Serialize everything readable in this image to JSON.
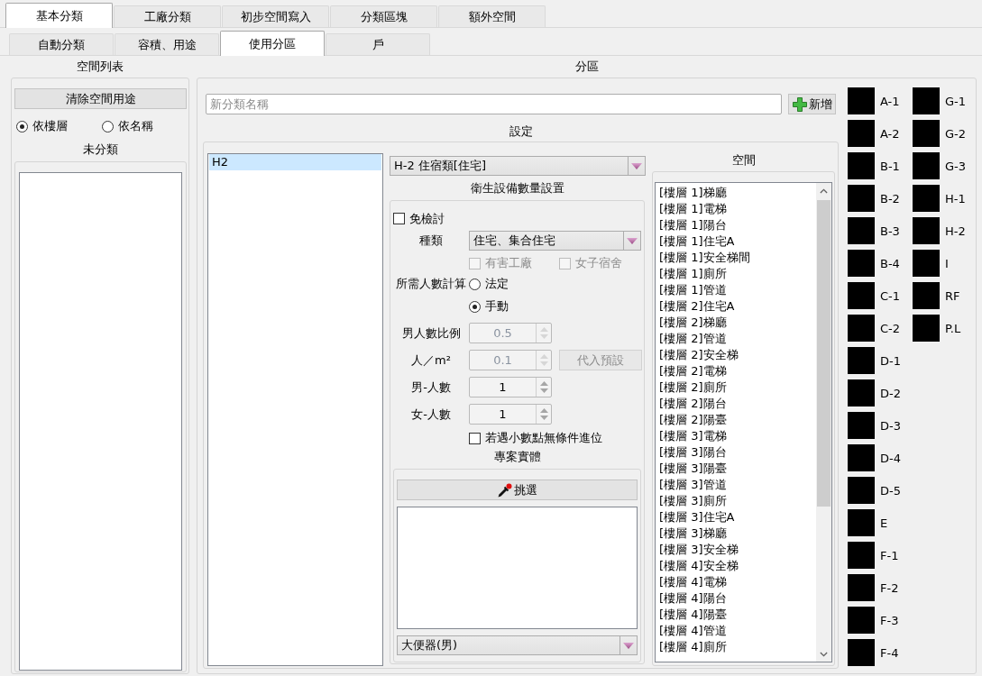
{
  "tabs": [
    {
      "label": "基本分類",
      "selected": true
    },
    {
      "label": "工廠分類",
      "selected": false
    },
    {
      "label": "初步空間寫入",
      "selected": false
    },
    {
      "label": "分類區塊",
      "selected": false
    },
    {
      "label": "額外空間",
      "selected": false
    }
  ],
  "subtabs": [
    {
      "label": "自動分類",
      "selected": false
    },
    {
      "label": "容積、用途",
      "selected": false
    },
    {
      "label": "使用分區",
      "selected": true
    },
    {
      "label": "戶",
      "selected": false
    }
  ],
  "space_list": {
    "title": "空間列表",
    "clear_button": "清除空間用途",
    "sort_options": [
      {
        "label": "依樓層",
        "selected": true
      },
      {
        "label": "依名稱",
        "selected": false
      }
    ],
    "unclassified_title": "未分類"
  },
  "zoning": {
    "title": "分區",
    "name_field": {
      "placeholder": "新分類名稱"
    },
    "add_button": "新增",
    "settings": {
      "title": "設定",
      "categories": [
        {
          "label": "H2",
          "selected": true
        }
      ],
      "use_type": "H-2 住宿類[住宅]",
      "sanitary": {
        "title": "衛生設備數量設置",
        "exempt": {
          "label": "免檢討",
          "checked": false
        },
        "type_label": "種類",
        "type_value": "住宅、集合住宅",
        "type_options": [
          {
            "label": "有害工廠",
            "checked": false,
            "disabled": true
          },
          {
            "label": "女子宿舍",
            "checked": false,
            "disabled": true
          }
        ],
        "calc_label": "所需人數計算",
        "calc_modes": [
          {
            "label": "法定",
            "selected": false
          },
          {
            "label": "手動",
            "selected": true
          }
        ],
        "fields": [
          {
            "label": "男人數比例",
            "value": "0.5",
            "disabled": true
          },
          {
            "label": "人／m²",
            "value": "0.1",
            "disabled": true,
            "button": {
              "label": "代入預設",
              "disabled": true
            }
          },
          {
            "label": "男-人數",
            "value": "1",
            "disabled": false
          },
          {
            "label": "女-人數",
            "value": "1",
            "disabled": false
          }
        ],
        "round_up": {
          "label": "若遇小數點無條件進位",
          "checked": false
        },
        "entities": {
          "title": "專案實體",
          "pick_button": "挑選",
          "fixture": "大便器(男)"
        }
      },
      "spaces": {
        "title": "空間",
        "items": [
          {
            "label": "[樓層 1]梯廳",
            "selected": false
          },
          {
            "label": "[樓層 1]電梯",
            "selected": false
          },
          {
            "label": "[樓層 1]陽台",
            "selected": false
          },
          {
            "label": "[樓層 1]住宅A",
            "selected": false
          },
          {
            "label": "[樓層 1]安全梯間",
            "selected": false
          },
          {
            "label": "[樓層 1]廁所",
            "selected": false
          },
          {
            "label": "[樓層 1]管道",
            "selected": false
          },
          {
            "label": "[樓層 2]住宅A",
            "selected": false
          },
          {
            "label": "[樓層 2]梯廳",
            "selected": false
          },
          {
            "label": "[樓層 2]管道",
            "selected": false
          },
          {
            "label": "[樓層 2]安全梯",
            "selected": false
          },
          {
            "label": "[樓層 2]電梯",
            "selected": false
          },
          {
            "label": "[樓層 2]廁所",
            "selected": false
          },
          {
            "label": "[樓層 2]陽台",
            "selected": false
          },
          {
            "label": "[樓層 2]陽臺",
            "selected": false
          },
          {
            "label": "[樓層 3]電梯",
            "selected": false
          },
          {
            "label": "[樓層 3]陽台",
            "selected": false
          },
          {
            "label": "[樓層 3]陽臺",
            "selected": false
          },
          {
            "label": "[樓層 3]管道",
            "selected": false
          },
          {
            "label": "[樓層 3]廁所",
            "selected": false
          },
          {
            "label": "[樓層 3]住宅A",
            "selected": false
          },
          {
            "label": "[樓層 3]梯廳",
            "selected": false
          },
          {
            "label": "[樓層 3]安全梯",
            "selected": false
          },
          {
            "label": "[樓層 4]安全梯",
            "selected": false
          },
          {
            "label": "[樓層 4]電梯",
            "selected": false
          },
          {
            "label": "[樓層 4]陽台",
            "selected": false
          },
          {
            "label": "[樓層 4]陽臺",
            "selected": false
          },
          {
            "label": "[樓層 4]管道",
            "selected": false
          },
          {
            "label": "[樓層 4]廁所",
            "selected": false
          }
        ]
      }
    }
  },
  "swatches": [
    {
      "label": "A-1",
      "color": "#000000"
    },
    {
      "label": "A-2",
      "color": "#000000"
    },
    {
      "label": "B-1",
      "color": "#000000"
    },
    {
      "label": "B-2",
      "color": "#000000"
    },
    {
      "label": "B-3",
      "color": "#000000"
    },
    {
      "label": "B-4",
      "color": "#000000"
    },
    {
      "label": "C-1",
      "color": "#000000"
    },
    {
      "label": "C-2",
      "color": "#000000"
    },
    {
      "label": "D-1",
      "color": "#000000"
    },
    {
      "label": "D-2",
      "color": "#000000"
    },
    {
      "label": "D-3",
      "color": "#000000"
    },
    {
      "label": "D-4",
      "color": "#000000"
    },
    {
      "label": "D-5",
      "color": "#000000"
    },
    {
      "label": "E",
      "color": "#000000"
    },
    {
      "label": "F-1",
      "color": "#000000"
    },
    {
      "label": "F-2",
      "color": "#000000"
    },
    {
      "label": "F-3",
      "color": "#000000"
    },
    {
      "label": "F-4",
      "color": "#000000"
    },
    {
      "label": "G-1",
      "color": "#000000"
    },
    {
      "label": "G-2",
      "color": "#000000"
    },
    {
      "label": "G-3",
      "color": "#000000"
    },
    {
      "label": "H-1",
      "color": "#000000"
    },
    {
      "label": "H-2",
      "color": "#000000"
    },
    {
      "label": "I",
      "color": "#000000"
    },
    {
      "label": "RF",
      "color": "#000000"
    },
    {
      "label": "P.L",
      "color": "#000000"
    }
  ]
}
